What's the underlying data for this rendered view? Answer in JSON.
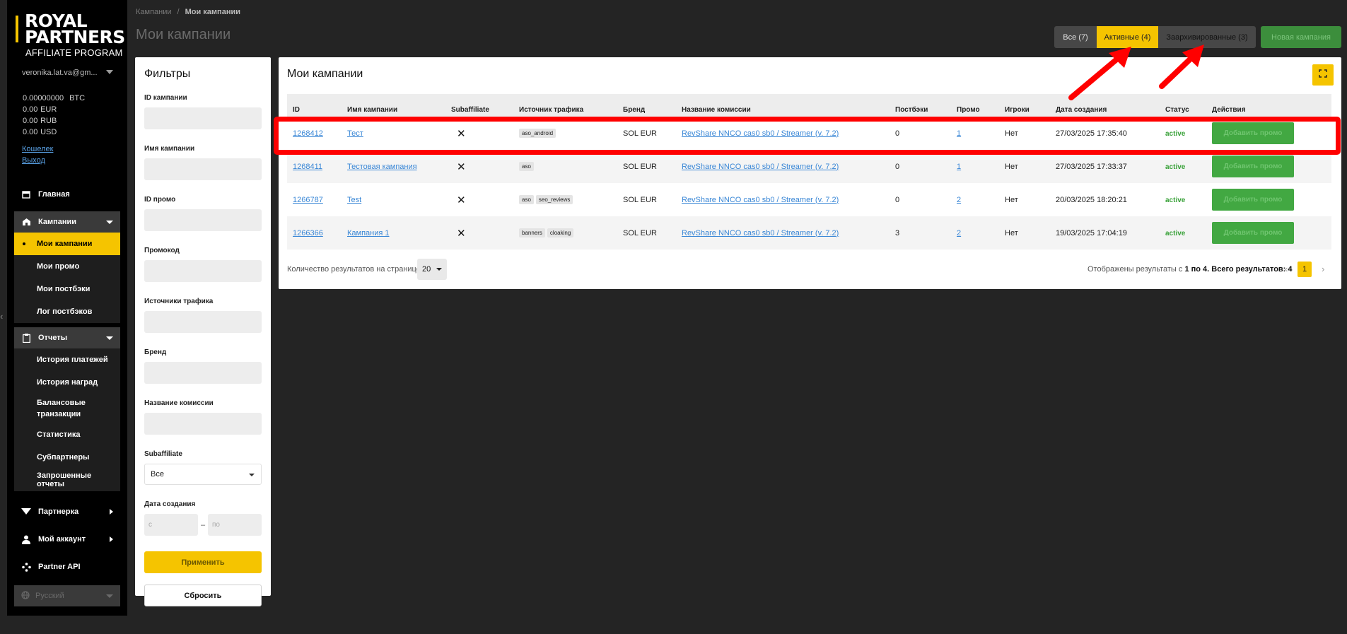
{
  "brand": {
    "line1": "ROYAL",
    "line2": "PARTNERS",
    "line3": "AFFILIATE PROGRAM",
    "accent_color": "#f5c400"
  },
  "user": {
    "email": "veronika.lat.va@gm...",
    "balances": [
      {
        "amount": "0.00000000",
        "currency": "BTC"
      },
      {
        "amount": "0.00",
        "currency": "EUR"
      },
      {
        "amount": "0.00",
        "currency": "RUB"
      },
      {
        "amount": "0.00",
        "currency": "USD"
      }
    ],
    "wallet_link": "Кошелек",
    "logout_link": "Выход"
  },
  "nav": {
    "home": {
      "label": "Главная",
      "icon": "home-icon"
    },
    "campaigns": {
      "label": "Кампании",
      "icon": "campaigns-icon",
      "items": [
        {
          "label": "Мои кампании",
          "active": true
        },
        {
          "label": "Мои промо"
        },
        {
          "label": "Мои постбэки"
        },
        {
          "label": "Лог постбэков"
        }
      ]
    },
    "reports": {
      "label": "Отчеты",
      "icon": "reports-icon",
      "items": [
        {
          "label": "История платежей"
        },
        {
          "label": "История наград"
        },
        {
          "label": "Балансовые транзакции"
        },
        {
          "label": "Статистика"
        },
        {
          "label": "Субпартнеры"
        },
        {
          "label": "Запрошенные отчеты"
        }
      ]
    },
    "partnerka": {
      "label": "Партнерка",
      "icon": "filter-funnel-icon"
    },
    "account": {
      "label": "Мой аккаунт",
      "icon": "user-icon"
    },
    "api": {
      "label": "Partner API",
      "icon": "api-icon"
    },
    "language": {
      "label": "Русский",
      "icon": "globe-icon"
    }
  },
  "header": {
    "breadcrumb": [
      "Кампании",
      "Мои кампании"
    ],
    "title": "Мои кампании",
    "tabs": [
      {
        "label": "Все (7)"
      },
      {
        "label": "Активные (4)",
        "selected": true
      },
      {
        "label": "Заархивированные (3)"
      }
    ],
    "new_campaign_label": "Новая кампания"
  },
  "filters": {
    "title": "Фильтры",
    "campaign_id_label": "ID кампании",
    "campaign_name_label": "Имя кампании",
    "promo_id_label": "ID промо",
    "promocode_label": "Промокод",
    "traffic_sources_label": "Источники трафика",
    "brand_label": "Бренд",
    "commission_name_label": "Название комиссии",
    "subaffiliate_label": "Subaffiliate",
    "subaffiliate_value": "Все",
    "date_label": "Дата создания",
    "date_from_placeholder": "с",
    "date_to_placeholder": "по",
    "apply_label": "Применить",
    "reset_label": "Сбросить"
  },
  "table": {
    "title": "Мои кампании",
    "columns": [
      "ID",
      "Имя кампании",
      "Subaffiliate",
      "Источник трафика",
      "Бренд",
      "Название комиссии",
      "Постбэки",
      "Промо",
      "Игроки",
      "Дата создания",
      "Статус",
      "Действия"
    ],
    "rows": [
      {
        "id": "1268412",
        "name": "Тест",
        "subaffiliate": "✕",
        "sources": [
          "aso_android"
        ],
        "brand": "SOL EUR",
        "commission": "RevShare NNCO cas0 sb0 / Streamer (v. 7.2)",
        "postbacks": "0",
        "promo": "1",
        "players": "Нет",
        "created": "27/03/2025 17:35:40",
        "status": "active",
        "action": "Добавить промо"
      },
      {
        "id": "1268411",
        "name": "Тестовая кампания",
        "subaffiliate": "✕",
        "sources": [
          "aso"
        ],
        "brand": "SOL EUR",
        "commission": "RevShare NNCO cas0 sb0 / Streamer (v. 7.2)",
        "postbacks": "0",
        "promo": "1",
        "players": "Нет",
        "created": "27/03/2025 17:33:37",
        "status": "active",
        "action": "Добавить промо"
      },
      {
        "id": "1266787",
        "name": "Test",
        "subaffiliate": "✕",
        "sources": [
          "aso",
          "seo_reviews"
        ],
        "brand": "SOL EUR",
        "commission": "RevShare NNCO cas0 sb0 / Streamer (v. 7.2)",
        "postbacks": "0",
        "promo": "2",
        "players": "Нет",
        "created": "20/03/2025 18:20:21",
        "status": "active",
        "action": "Добавить промо"
      },
      {
        "id": "1266366",
        "name": "Кампания 1",
        "subaffiliate": "✕",
        "sources": [
          "banners",
          "cloaking"
        ],
        "brand": "SOL EUR",
        "commission": "RevShare NNCO cas0 sb0 / Streamer (v. 7.2)",
        "postbacks": "3",
        "promo": "2",
        "players": "Нет",
        "created": "19/03/2025 17:04:19",
        "status": "active",
        "action": "Добавить промо"
      }
    ]
  },
  "pagination": {
    "per_page_label": "Количество результатов на странице",
    "per_page_value": "20",
    "results_prefix": "Отображены результаты с",
    "results_range": "1 по 4. Всего результатов: 4",
    "current_page": "1",
    "prev": "‹",
    "next": "›"
  },
  "colors": {
    "annotation_red": "#ff0000",
    "status_green": "#3aa23a",
    "action_green": "#42a842",
    "link_blue": "#3a87d6"
  }
}
